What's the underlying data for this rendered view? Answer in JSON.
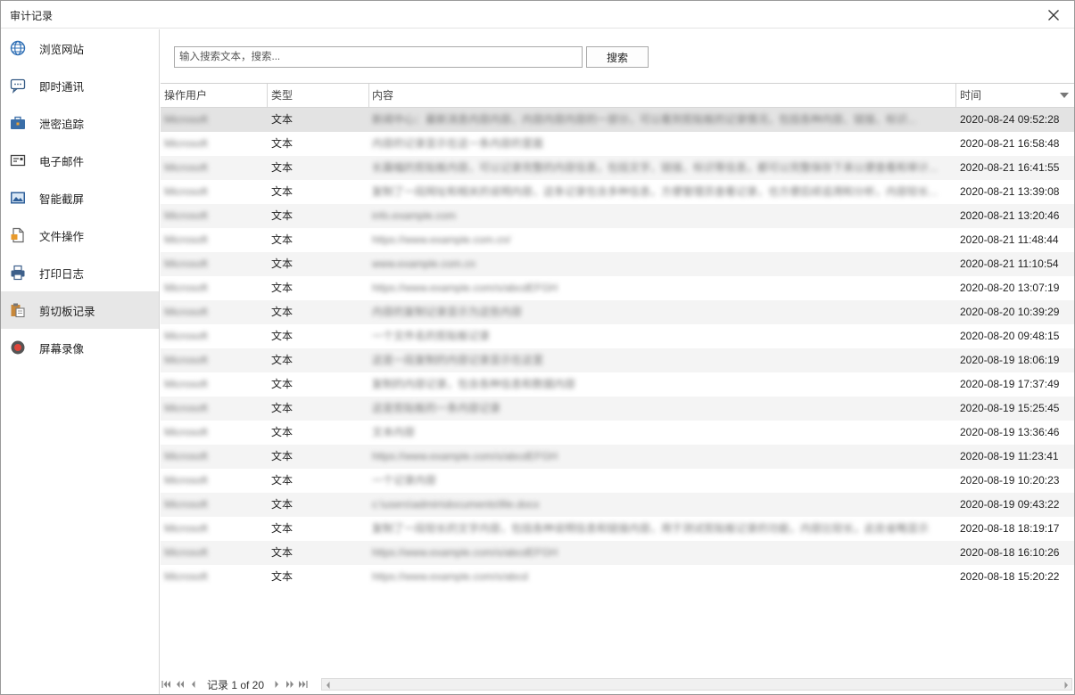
{
  "window": {
    "title": "审计记录"
  },
  "sidebar": {
    "items": [
      {
        "label": "浏览网站",
        "icon": "globe-icon"
      },
      {
        "label": "即时通讯",
        "icon": "chat-icon"
      },
      {
        "label": "泄密追踪",
        "icon": "toolbox-icon"
      },
      {
        "label": "电子邮件",
        "icon": "email-icon"
      },
      {
        "label": "智能截屏",
        "icon": "screenshot-icon"
      },
      {
        "label": "文件操作",
        "icon": "file-icon"
      },
      {
        "label": "打印日志",
        "icon": "printer-icon"
      },
      {
        "label": "剪切板记录",
        "icon": "clipboard-icon",
        "active": true
      },
      {
        "label": "屏幕录像",
        "icon": "record-icon"
      }
    ]
  },
  "search": {
    "placeholder": "输入搜索文本，搜索...",
    "button_label": "搜索"
  },
  "table": {
    "columns": {
      "user": "操作用户",
      "type": "类型",
      "content": "内容",
      "time": "时间"
    },
    "rows": [
      {
        "user": "Microsoft",
        "type": "文本",
        "content": "新闻中心：最新消息内容内容，内容内容内容的一部分，可以看到剪贴板的记录情况，包括各种内容、链接、标识...",
        "time": "2020-08-24 09:52:28"
      },
      {
        "user": "Microsoft",
        "type": "文本",
        "content": "内容的记录显示在这一条内容的里面",
        "time": "2020-08-21 16:58:48"
      },
      {
        "user": "Microsoft",
        "type": "文本",
        "content": "长篇幅的剪贴板内容，可以记录完整的内容信息，包括文字、链接、标识等信息，都可以完整保存下来以便查看和审计...",
        "time": "2020-08-21 16:41:55"
      },
      {
        "user": "Microsoft",
        "type": "文本",
        "content": "复制了一段网址和相关的说明内容，这条记录包含多种信息，方便管理员查看记录，也方便后续追溯和分析，内容较长...",
        "time": "2020-08-21 13:39:08"
      },
      {
        "user": "Microsoft",
        "type": "文本",
        "content": "info.example.com",
        "time": "2020-08-21 13:20:46"
      },
      {
        "user": "Microsoft",
        "type": "文本",
        "content": "https://www.example.com.cn/",
        "time": "2020-08-21 11:48:44"
      },
      {
        "user": "Microsoft",
        "type": "文本",
        "content": "www.example.com.cn",
        "time": "2020-08-21 11:10:54"
      },
      {
        "user": "Microsoft",
        "type": "文本",
        "content": "https://www.example.com/s/abcdEFGH",
        "time": "2020-08-20 13:07:19"
      },
      {
        "user": "Microsoft",
        "type": "文本",
        "content": "内容的复制记录显示为这些内容",
        "time": "2020-08-20 10:39:29"
      },
      {
        "user": "Microsoft",
        "type": "文本",
        "content": "一个文件名的剪贴板记录",
        "time": "2020-08-20 09:48:15"
      },
      {
        "user": "Microsoft",
        "type": "文本",
        "content": "这是一段复制的内容记录显示在这里",
        "time": "2020-08-19 18:06:19"
      },
      {
        "user": "Microsoft",
        "type": "文本",
        "content": "复制的内容记录，包含各种信息和数据内容",
        "time": "2020-08-19 17:37:49"
      },
      {
        "user": "Microsoft",
        "type": "文本",
        "content": "这是剪贴板的一条内容记录",
        "time": "2020-08-19 15:25:45"
      },
      {
        "user": "Microsoft",
        "type": "文本",
        "content": "文本内容",
        "time": "2020-08-19 13:36:46"
      },
      {
        "user": "Microsoft",
        "type": "文本",
        "content": "https://www.example.com/s/abcdEFGH",
        "time": "2020-08-19 11:23:41"
      },
      {
        "user": "Microsoft",
        "type": "文本",
        "content": "一个记录内容",
        "time": "2020-08-19 10:20:23"
      },
      {
        "user": "Microsoft",
        "type": "文本",
        "content": "c:\\users\\admin\\documents\\file.docx",
        "time": "2020-08-19 09:43:22"
      },
      {
        "user": "Microsoft",
        "type": "文本",
        "content": "复制了一段较长的文字内容，包括各种说明信息和链接内容，用于测试剪贴板记录的功能，内容比较长，此处省略显示",
        "time": "2020-08-18 18:19:17"
      },
      {
        "user": "Microsoft",
        "type": "文本",
        "content": "https://www.example.com/s/abcdEFGH",
        "time": "2020-08-18 16:10:26"
      },
      {
        "user": "Microsoft",
        "type": "文本",
        "content": "https://www.example.com/s/abcd",
        "time": "2020-08-18 15:20:22"
      }
    ]
  },
  "pager": {
    "info": "记录 1 of 20"
  },
  "colors": {
    "selected_row": "#e3e3e3",
    "alt_row": "#f4f4f4",
    "active_nav": "#e7e7e7"
  }
}
